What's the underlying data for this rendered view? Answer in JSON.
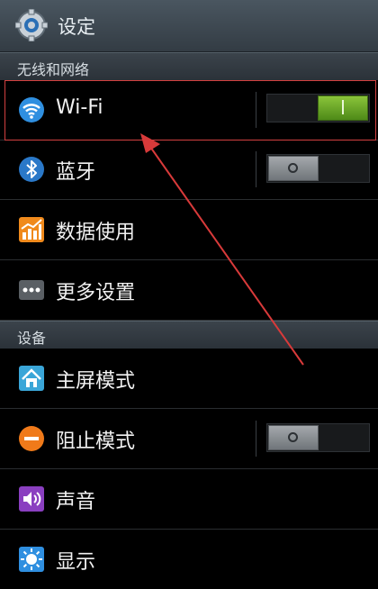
{
  "header": {
    "title": "设定",
    "icon": "settings-gear-icon"
  },
  "sections": {
    "network": {
      "label": "无线和网络"
    },
    "device": {
      "label": "设备"
    }
  },
  "items": {
    "wifi": {
      "label": "Wi-Fi",
      "icon": "wifi-icon",
      "toggle_state": "on"
    },
    "bluetooth": {
      "label": "蓝牙",
      "icon": "bluetooth-icon",
      "toggle_state": "off"
    },
    "data_usage": {
      "label": "数据使用",
      "icon": "data-usage-chart-icon"
    },
    "more_settings": {
      "label": "更多设置",
      "icon": "more-dots-icon"
    },
    "home_screen": {
      "label": "主屏模式",
      "icon": "home-icon"
    },
    "blocking_mode": {
      "label": "阻止模式",
      "icon": "block-icon",
      "toggle_state": "off"
    },
    "sound": {
      "label": "声音",
      "icon": "sound-icon"
    },
    "display": {
      "label": "显示",
      "icon": "display-brightness-icon"
    }
  },
  "colors": {
    "highlight_box": "#d24040",
    "toggle_on": "#6fae2c",
    "toggle_off": "#8b9094"
  }
}
